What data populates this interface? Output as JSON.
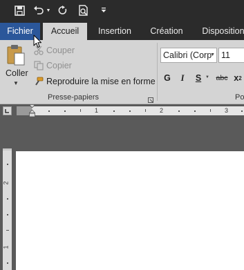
{
  "quick_access": {
    "icons": [
      "save-icon",
      "undo-icon",
      "undo-dropdown-icon",
      "redo-icon",
      "print-preview-icon",
      "customize-qat-icon"
    ]
  },
  "tabs": [
    {
      "label": "Fichier"
    },
    {
      "label": "Accueil"
    },
    {
      "label": "Insertion"
    },
    {
      "label": "Création"
    },
    {
      "label": "Disposition"
    }
  ],
  "clipboard": {
    "paste_label": "Coller",
    "cut_label": "Couper",
    "copy_label": "Copier",
    "format_painter_label": "Reproduire la mise en forme",
    "group_label": "Presse-papiers"
  },
  "font": {
    "font_name": "Calibri (Corp",
    "font_size": "11",
    "bold_label": "G",
    "italic_label": "I",
    "underline_label": "S",
    "strikethrough_label": "abc",
    "subscript_label": "x",
    "group_label_partial": "Po"
  },
  "ruler": {
    "numbers": [
      "1",
      "2",
      "3"
    ],
    "vertical_numbers": [
      "2",
      "1"
    ]
  },
  "colors": {
    "title_bar": "#2b2b2b",
    "file_tab": "#2b579a",
    "ribbon": "#d4d4d4",
    "workspace": "#5a5a5a"
  }
}
